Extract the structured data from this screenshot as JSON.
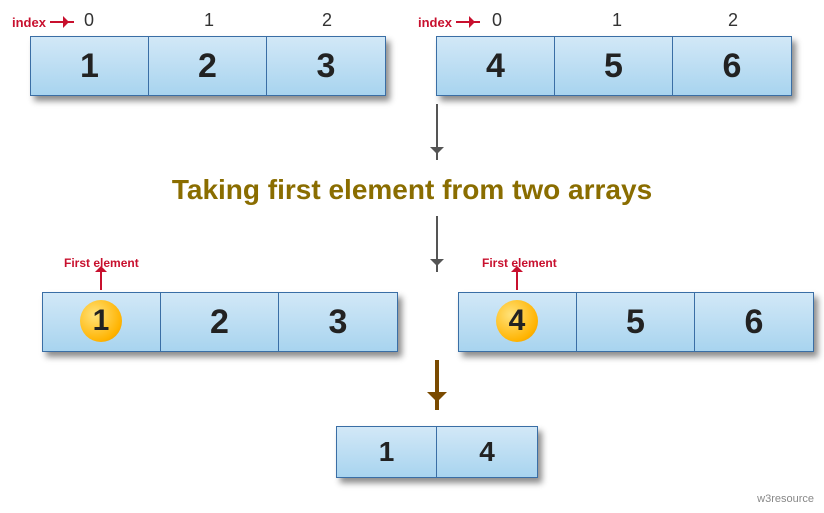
{
  "labels": {
    "index": "index",
    "first_element": "First element",
    "title": "Taking first element from two arrays",
    "watermark": "w3resource"
  },
  "array1": {
    "indices": [
      "0",
      "1",
      "2"
    ],
    "values": [
      "1",
      "2",
      "3"
    ]
  },
  "array2": {
    "indices": [
      "0",
      "1",
      "2"
    ],
    "values": [
      "4",
      "5",
      "6"
    ]
  },
  "result": {
    "values": [
      "1",
      "4"
    ]
  },
  "highlights": {
    "array1_first": "1",
    "array2_first": "4"
  }
}
